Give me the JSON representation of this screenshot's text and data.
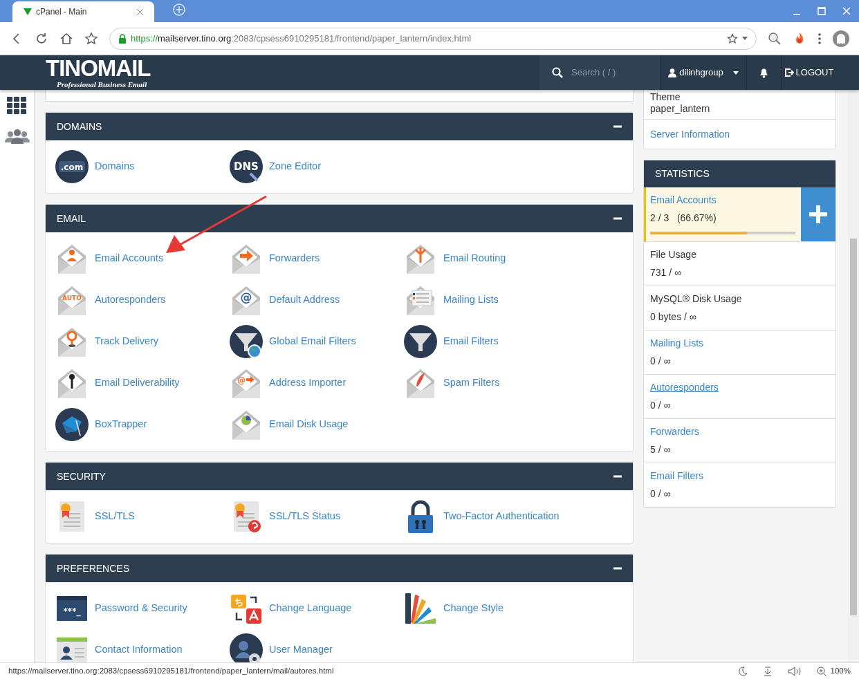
{
  "browser": {
    "tab_title": "cPanel - Main",
    "url": {
      "scheme": "https://",
      "host": "mailserver.tino.org",
      "path": ":2083/cpsess6910295181/frontend/paper_lantern/index.html"
    },
    "status_url": "https://mailserver.tino.org:2083/cpsess6910295181/frontend/paper_lantern/mail/autores.html",
    "zoom": "100%"
  },
  "header": {
    "logo": "TINOMAIL",
    "tagline": "Professional Business Email",
    "search_placeholder": "Search ( / )",
    "user": "dilinhgroup",
    "logout": "LOGOUT"
  },
  "sections": [
    {
      "title": "DOMAINS",
      "expanded": true,
      "items": [
        {
          "label": "Domains",
          "icon_text": ".com"
        },
        {
          "label": "Zone Editor",
          "icon_text": "DNS"
        }
      ]
    },
    {
      "title": "EMAIL",
      "expanded": true,
      "items": [
        {
          "label": "Email Accounts"
        },
        {
          "label": "Forwarders"
        },
        {
          "label": "Email Routing"
        },
        {
          "label": "Autoresponders",
          "icon_text": "AUTO"
        },
        {
          "label": "Default Address",
          "icon_text": "@"
        },
        {
          "label": "Mailing Lists"
        },
        {
          "label": "Track Delivery"
        },
        {
          "label": "Global Email Filters"
        },
        {
          "label": "Email Filters"
        },
        {
          "label": "Email Deliverability"
        },
        {
          "label": "Address Importer",
          "icon_text": "@"
        },
        {
          "label": "Spam Filters"
        },
        {
          "label": "BoxTrapper"
        },
        {
          "label": "Email Disk Usage"
        }
      ]
    },
    {
      "title": "SECURITY",
      "expanded": true,
      "items": [
        {
          "label": "SSL/TLS"
        },
        {
          "label": "SSL/TLS Status"
        },
        {
          "label": "Two-Factor Authentication"
        }
      ]
    },
    {
      "title": "PREFERENCES",
      "expanded": true,
      "items": [
        {
          "label": "Password & Security",
          "icon_text": "***_"
        },
        {
          "label": "Change Language",
          "icon_text": "ち"
        },
        {
          "label": "Change Style"
        },
        {
          "label": "Contact Information"
        },
        {
          "label": "User Manager"
        }
      ]
    }
  ],
  "general_info": {
    "theme_label": "Theme",
    "theme_value": "paper_lantern",
    "link": "Server Information"
  },
  "statistics": {
    "title": "STATISTICS",
    "items": [
      {
        "label": "Email Accounts",
        "value": "2 / 3   (66.67%)",
        "kind": "link",
        "highlighted": true,
        "hovered": false,
        "add_button": true,
        "level": 0.6667
      },
      {
        "label": "File Usage",
        "value": "731 / ∞",
        "kind": "text",
        "highlighted": false,
        "hovered": false,
        "add_button": false
      },
      {
        "label": "MySQL® Disk Usage",
        "value": "0 bytes / ∞",
        "kind": "text",
        "highlighted": false,
        "hovered": false,
        "add_button": false
      },
      {
        "label": "Mailing Lists",
        "value": "0 / ∞",
        "kind": "link",
        "highlighted": false,
        "hovered": false,
        "add_button": false
      },
      {
        "label": "Autoresponders",
        "value": "0 / ∞",
        "kind": "link",
        "highlighted": false,
        "hovered": true,
        "add_button": false
      },
      {
        "label": "Forwarders",
        "value": "5 / ∞",
        "kind": "link",
        "highlighted": false,
        "hovered": false,
        "add_button": false
      },
      {
        "label": "Email Filters",
        "value": "0 / ∞",
        "kind": "link",
        "highlighted": false,
        "hovered": false,
        "add_button": false
      }
    ]
  }
}
